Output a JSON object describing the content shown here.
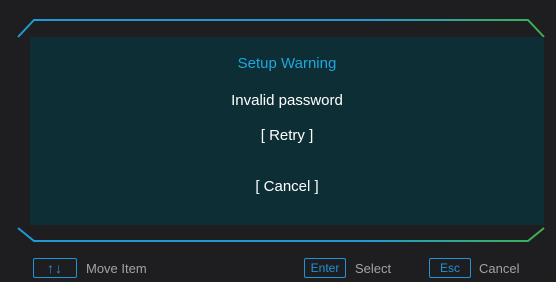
{
  "dialog": {
    "title": "Setup Warning",
    "message": "Invalid password",
    "options": [
      "[ Retry ]",
      "[ Cancel ]"
    ]
  },
  "footer": {
    "move": {
      "key": "↑↓",
      "label": "Move Item"
    },
    "select": {
      "key": "Enter",
      "label": "Select"
    },
    "cancel": {
      "key": "Esc",
      "label": "Cancel"
    }
  },
  "colors": {
    "background": "#1e1d1f",
    "panel": "#0d2e35",
    "title": "#1ea7e0",
    "frame_blue": "#1e9bd7",
    "frame_green": "#3fb24f",
    "key_border": "#1f93d6"
  }
}
